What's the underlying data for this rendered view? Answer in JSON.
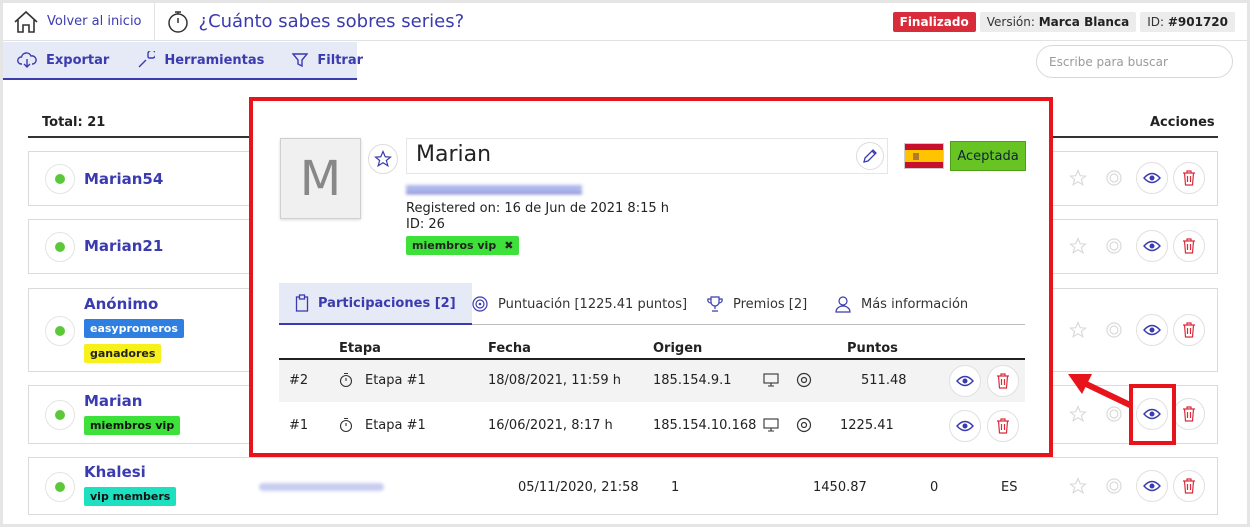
{
  "header": {
    "home_label": "Volver al inicio",
    "title": "¿Cuánto sabes sobres series?",
    "status_badge": "Finalizado",
    "version_label": "Versión:",
    "version_value": "Marca Blanca",
    "id_label": "ID:",
    "id_value": "#901720"
  },
  "toolbar": {
    "export_label": "Exportar",
    "tools_label": "Herramientas",
    "filter_label": "Filtrar"
  },
  "search": {
    "placeholder": "Escribe para buscar"
  },
  "list": {
    "total_label": "Total: 21",
    "actions_header": "Acciones",
    "rows": [
      {
        "name": "Marian54",
        "tags": []
      },
      {
        "name": "Marian21",
        "tags": []
      },
      {
        "name": "Anónimo",
        "tags": [
          "easypromeros",
          "ganadores"
        ]
      },
      {
        "name": "Marian",
        "tags": [
          "miembros vip"
        ]
      },
      {
        "name": "Khalesi",
        "tags": [
          "vip members"
        ],
        "date": "05/11/2020, 21:58",
        "col_a": "1",
        "points": "1450.87",
        "col_b": "0",
        "lang": "ES"
      }
    ]
  },
  "modal": {
    "avatar_letter": "M",
    "name": "Marian",
    "status": "Aceptada",
    "registered": "Registered on: 16 de Jun de 2021 8:15 h",
    "id_line": "ID: 26",
    "tag": "miembros vip",
    "tabs": {
      "participaciones": "Participaciones [2]",
      "puntuacion": "Puntuación [1225.41 puntos]",
      "premios": "Premios [2]",
      "mas_info": "Más información"
    },
    "table": {
      "headers": {
        "etapa": "Etapa",
        "fecha": "Fecha",
        "origen": "Origen",
        "puntos": "Puntos"
      },
      "rows": [
        {
          "num": "#2",
          "etapa": "Etapa #1",
          "fecha": "18/08/2021, 11:59 h",
          "ip": "185.154.9.1",
          "puntos": "511.48"
        },
        {
          "num": "#1",
          "etapa": "Etapa #1",
          "fecha": "16/06/2021, 8:17 h",
          "ip": "185.154.10.168",
          "puntos": "1225.41"
        }
      ]
    }
  },
  "colors": {
    "accent": "#3b3bb0",
    "highlight": "#e8141c",
    "online": "#5bc83a",
    "accepted": "#67c423",
    "danger": "#d92c3b"
  }
}
